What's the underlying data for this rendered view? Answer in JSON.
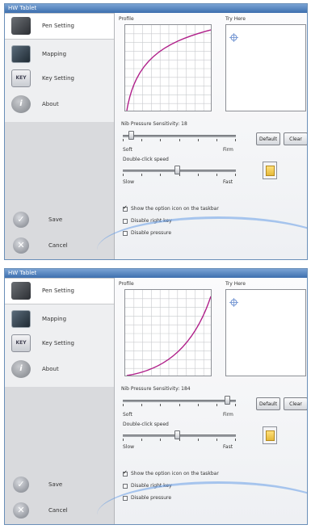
{
  "windows": [
    {
      "title": "HW Tablet",
      "sidebar": {
        "items": [
          {
            "label": "Pen Setting",
            "icon": "pen-tablet-icon"
          },
          {
            "label": "Mapping",
            "icon": "mapping-icon"
          },
          {
            "label": "Key Setting",
            "icon": "key-icon",
            "icon_text": "KEY"
          },
          {
            "label": "About",
            "icon": "info-icon",
            "icon_text": "i"
          }
        ],
        "save_label": "Save",
        "cancel_label": "Cancel"
      },
      "profile_label": "Profile",
      "try_label": "Try Here",
      "nib_label": "Nib Pressure Sensitivity: 18",
      "nib_soft": "Soft",
      "nib_firm": "Firm",
      "nib_value": 0.05,
      "dbl_label": "Double-click speed",
      "dbl_slow": "Slow",
      "dbl_fast": "Fast",
      "dbl_value": 0.48,
      "default_label": "Default",
      "clear_label": "Clear",
      "checks": [
        {
          "label": "Show the option icon on the taskbar",
          "checked": true
        },
        {
          "label": "Disable right key",
          "checked": false
        },
        {
          "label": "Disable pressure",
          "checked": false
        }
      ],
      "curve": "concave",
      "accent_color": "#b0208a"
    },
    {
      "title": "HW Tablet",
      "sidebar": {
        "items": [
          {
            "label": "Pen Setting",
            "icon": "pen-tablet-icon"
          },
          {
            "label": "Mapping",
            "icon": "mapping-icon"
          },
          {
            "label": "Key Setting",
            "icon": "key-icon",
            "icon_text": "KEY"
          },
          {
            "label": "About",
            "icon": "info-icon",
            "icon_text": "i"
          }
        ],
        "save_label": "Save",
        "cancel_label": "Cancel"
      },
      "profile_label": "Profile",
      "try_label": "Try Here",
      "nib_label": "Nib Pressure Sensitivity: 184",
      "nib_soft": "Soft",
      "nib_firm": "Firm",
      "nib_value": 0.95,
      "dbl_label": "Double-click speed",
      "dbl_slow": "Slow",
      "dbl_fast": "Fast",
      "dbl_value": 0.48,
      "default_label": "Default",
      "clear_label": "Clear",
      "checks": [
        {
          "label": "Show the option icon on the taskbar",
          "checked": true
        },
        {
          "label": "Disable right key",
          "checked": false
        },
        {
          "label": "Disable pressure",
          "checked": false
        }
      ],
      "curve": "convex",
      "accent_color": "#b0208a"
    }
  ]
}
